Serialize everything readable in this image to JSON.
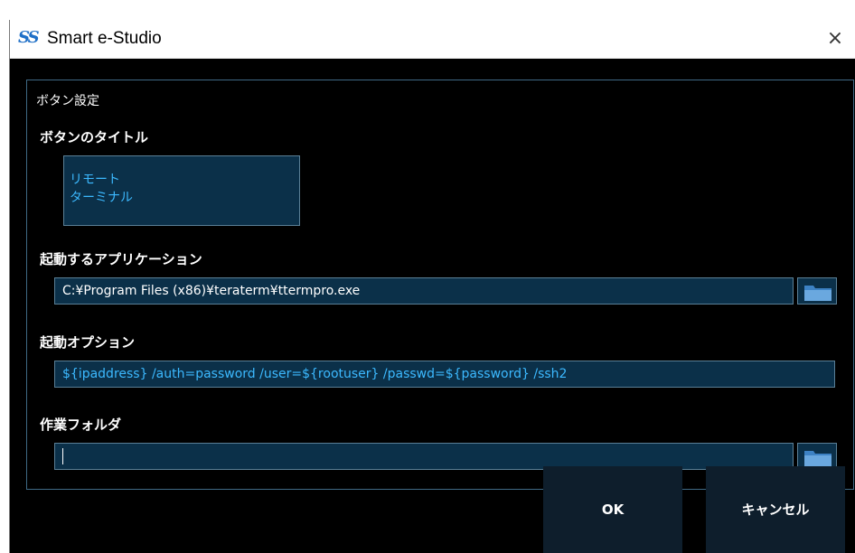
{
  "window": {
    "title": "Smart e-Studio",
    "icon_name": "app-logo-icon",
    "icon_text": "SS",
    "close_glyph": "×"
  },
  "group": {
    "title": "ボタン設定"
  },
  "button_title": {
    "label": "ボタンのタイトル",
    "lines": [
      "リモート",
      "ターミナル"
    ]
  },
  "application": {
    "label": "起動するアプリケーション",
    "value": "C:¥Program Files (x86)¥teraterm¥ttermpro.exe",
    "browse_icon": "folder-icon"
  },
  "options": {
    "label": "起動オプション",
    "value": "${ipaddress} /auth=password /user=${rootuser} /passwd=${password} /ssh2"
  },
  "workdir": {
    "label": "作業フォルダ",
    "value": "",
    "browse_icon": "folder-icon"
  },
  "footer": {
    "ok_label": "OK",
    "cancel_label": "キャンセル"
  },
  "colors": {
    "background": "#000000",
    "field_background": "#0b3049",
    "accent_text": "#3cb9ff",
    "button_background": "#0e1e2c"
  }
}
